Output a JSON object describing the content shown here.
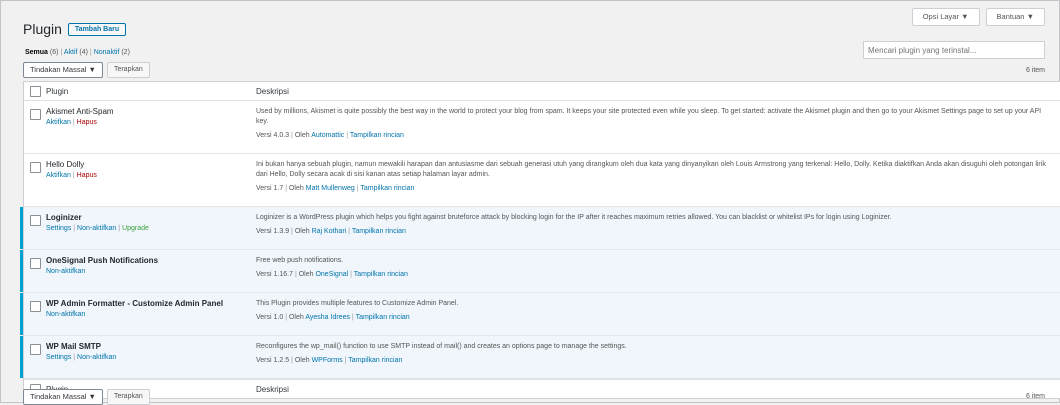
{
  "header": {
    "title": "Plugin",
    "add_new": "Tambah Baru",
    "screen_options": "Opsi Layar",
    "help": "Bantuan"
  },
  "filters": {
    "all": "Semua",
    "all_count": "(6)",
    "active": "Aktif",
    "active_count": "(4)",
    "inactive": "Nonaktif",
    "inactive_count": "(2)"
  },
  "search": {
    "placeholder": "Mencari plugin yang terinstal..."
  },
  "tablenav": {
    "bulk_select": "Tindakan Massal",
    "apply": "Terapkan",
    "items": "6 item"
  },
  "table": {
    "col_plugin": "Plugin",
    "col_desc": "Deskripsi"
  },
  "labels": {
    "version_prefix": "Versi",
    "by": "Oleh",
    "details": "Tampilkan rincian",
    "activate": "Aktifkan",
    "delete": "Hapus",
    "settings": "Settings",
    "deactivate": "Non-aktifkan",
    "upgrade": "Upgrade"
  },
  "plugins": [
    {
      "name": "Akismet Anti-Spam",
      "description": "Used by millions, Akismet is quite possibly the best way in the world to protect your blog from spam. It keeps your site protected even while you sleep. To get started: activate the Akismet plugin and then go to your Akismet Settings page to set up your API key.",
      "version": "4.0.3",
      "author": "Automattic"
    },
    {
      "name": "Hello Dolly",
      "description": "Ini bukan hanya sebuah plugin, namun mewakili harapan dan antusiasme dari sebuah generasi utuh yang dirangkum oleh dua kata yang dinyanyikan oleh Louis Armstrong yang terkenal: Hello, Dolly. Ketika diaktifkan Anda akan disuguhi oleh potongan lirik dari Hello, Dolly secara acak di sisi kanan atas setiap halaman layar admin.",
      "version": "1.7",
      "author": "Matt Mullenweg"
    },
    {
      "name": "Loginizer",
      "description": "Loginizer is a WordPress plugin which helps you fight against bruteforce attack by blocking login for the IP after it reaches maximum retries allowed. You can blacklist or whitelist IPs for login using Loginizer.",
      "version": "1.3.9",
      "author": "Raj Kothari"
    },
    {
      "name": "OneSignal Push Notifications",
      "description": "Free web push notifications.",
      "version": "1.16.7",
      "author": "OneSignal"
    },
    {
      "name": "WP Admin Formatter - Customize Admin Panel",
      "description": "This Plugin provides multiple features to Customize Admin Panel.",
      "version": "1.0",
      "author": "Ayesha Idrees"
    },
    {
      "name": "WP Mail SMTP",
      "description": "Reconfigures the wp_mail() function to use SMTP instead of mail() and creates an options page to manage the settings.",
      "version": "1.2.5",
      "author": "WPForms"
    }
  ]
}
